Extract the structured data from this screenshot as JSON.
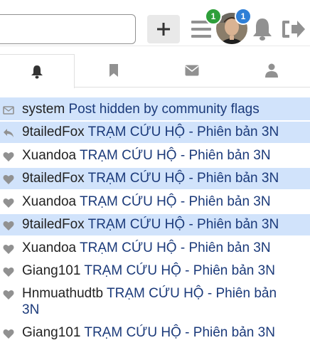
{
  "header": {
    "search_placeholder": "",
    "plus_icon": "plus-icon",
    "menu_badge": "1",
    "avatar_badge": "1"
  },
  "tabs": [
    {
      "icon": "bell-icon",
      "active": true
    },
    {
      "icon": "bookmark-icon",
      "active": false
    },
    {
      "icon": "envelope-icon",
      "active": false
    },
    {
      "icon": "user-icon",
      "active": false
    }
  ],
  "notifications": [
    {
      "icon": "envelope-icon",
      "user": "system",
      "text": "Post hidden by community flags",
      "highlighted": true
    },
    {
      "icon": "reply-icon",
      "user": "9tailedFox",
      "text": "TRẠM CỨU HỘ - Phiên bản 3N",
      "highlighted": true
    },
    {
      "icon": "heart-icon",
      "user": "Xuandoa",
      "text": "TRẠM CỨU HỘ - Phiên bản 3N",
      "highlighted": false
    },
    {
      "icon": "heart-icon",
      "user": "9tailedFox",
      "text": "TRẠM CỨU HỘ - Phiên bản 3N",
      "highlighted": true
    },
    {
      "icon": "heart-icon",
      "user": "Xuandoa",
      "text": "TRẠM CỨU HỘ - Phiên bản 3N",
      "highlighted": false
    },
    {
      "icon": "heart-icon",
      "user": "9tailedFox",
      "text": "TRẠM CỨU HỘ - Phiên bản 3N",
      "highlighted": true
    },
    {
      "icon": "heart-icon",
      "user": "Xuandoa",
      "text": "TRẠM CỨU HỘ - Phiên bản 3N",
      "highlighted": false
    },
    {
      "icon": "heart-icon",
      "user": "Giang101",
      "text": "TRẠM CỨU HỘ - Phiên bản 3N",
      "highlighted": false
    },
    {
      "icon": "heart-icon",
      "user": "Hnmuathudtb",
      "text": "TRẠM CỨU HỘ - Phiên bản 3N",
      "highlighted": false
    },
    {
      "icon": "heart-icon",
      "user": "Giang101",
      "text": "TRẠM CỨU HỘ - Phiên bản 3N",
      "highlighted": false
    }
  ],
  "colors": {
    "highlight": "#d1e3fb",
    "topic_link": "#1b3a7a",
    "badge_green": "#2e9f3a",
    "badge_blue": "#2f7fd6",
    "icon_gray": "#919191"
  }
}
